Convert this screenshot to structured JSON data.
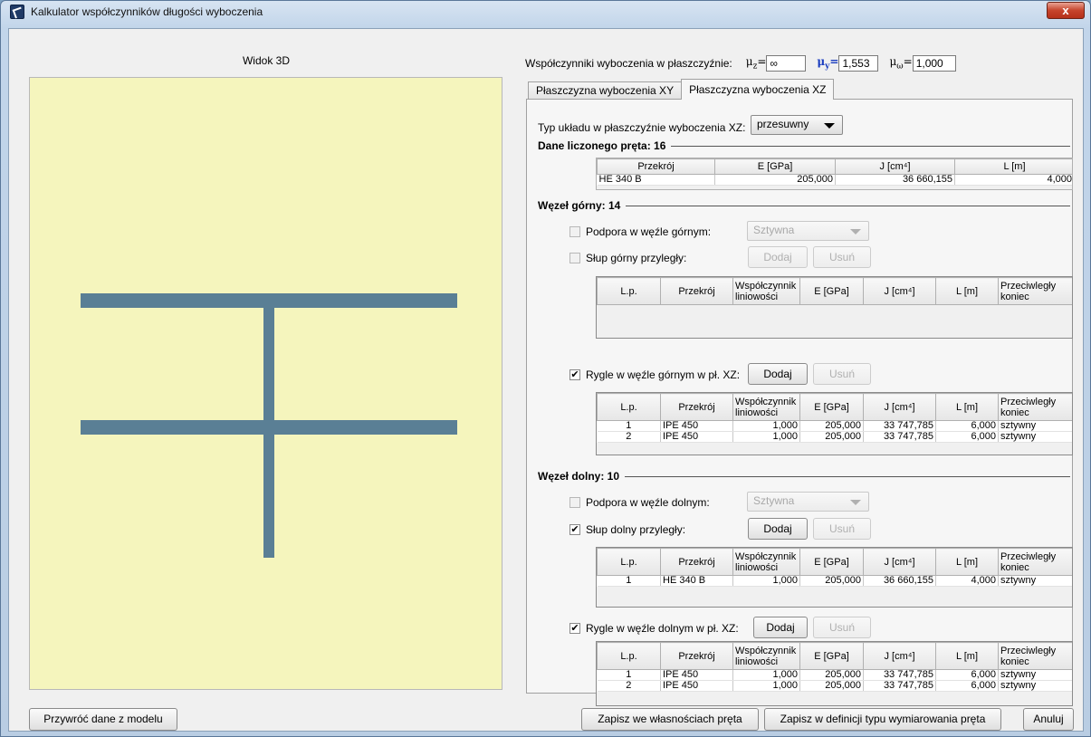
{
  "window": {
    "title": "Kalkulator współczynników długości wyboczenia",
    "close_label": "x"
  },
  "view3d": {
    "title": "Widok 3D",
    "background": "#f5f5bd",
    "member_color": "#5a7f95"
  },
  "coefficients": {
    "label": "Współczynniki wyboczenia w płaszczyźnie:",
    "mu_z": {
      "symbol": "μ",
      "sub": "z",
      "value": "∞"
    },
    "mu_y": {
      "symbol": "μ",
      "sub": "y",
      "value": "1,553"
    },
    "mu_w": {
      "symbol": "μ",
      "sub": "ω",
      "value": "1,000"
    }
  },
  "tabs": [
    {
      "label": "Płaszczyzna wyboczenia XY",
      "active": false
    },
    {
      "label": "Płaszczyzna wyboczenia XZ",
      "active": true
    }
  ],
  "system_type": {
    "label": "Typ układu w płaszczyźnie wyboczenia XZ:",
    "value": "przesuwny"
  },
  "member": {
    "title": "Dane liczonego pręta: 16",
    "headers": [
      "Przekrój",
      "E [GPa]",
      "J [cm⁴]",
      "L [m]"
    ],
    "row": [
      "HE 340 B",
      "205,000",
      "36 660,155",
      "4,000"
    ]
  },
  "grid_headers": [
    "L.p.",
    "Przekrój",
    "Współczynnik liniowości",
    "E [GPa]",
    "J [cm⁴]",
    "L [m]",
    "Przeciwległy koniec"
  ],
  "upper_node": {
    "title": "Węzeł górny: 14",
    "support": {
      "label": "Podpora w węźle górnym:",
      "checked": false,
      "combo": "Sztywna"
    },
    "column": {
      "label": "Słup górny przyległy:",
      "checked": false,
      "add": "Dodaj",
      "remove": "Usuń",
      "rows": []
    },
    "beams": {
      "label": "Rygle w węźle górnym w pł. XZ:",
      "checked": true,
      "add": "Dodaj",
      "remove": "Usuń",
      "rows": [
        [
          "1",
          "IPE 450",
          "1,000",
          "205,000",
          "33 747,785",
          "6,000",
          "sztywny"
        ],
        [
          "2",
          "IPE 450",
          "1,000",
          "205,000",
          "33 747,785",
          "6,000",
          "sztywny"
        ]
      ]
    }
  },
  "lower_node": {
    "title": "Węzeł dolny: 10",
    "support": {
      "label": "Podpora w węźle dolnym:",
      "checked": false,
      "combo": "Sztywna"
    },
    "column": {
      "label": "Słup dolny przyległy:",
      "checked": true,
      "add": "Dodaj",
      "remove": "Usuń",
      "rows": [
        [
          "1",
          "HE 340 B",
          "1,000",
          "205,000",
          "36 660,155",
          "4,000",
          "sztywny"
        ]
      ]
    },
    "beams": {
      "label": "Rygle w węźle dolnym w pł. XZ:",
      "checked": true,
      "add": "Dodaj",
      "remove": "Usuń",
      "rows": [
        [
          "1",
          "IPE 450",
          "1,000",
          "205,000",
          "33 747,785",
          "6,000",
          "sztywny"
        ],
        [
          "2",
          "IPE 450",
          "1,000",
          "205,000",
          "33 747,785",
          "6,000",
          "sztywny"
        ]
      ]
    }
  },
  "footer": {
    "restore": "Przywróć dane z modelu",
    "save_member": "Zapisz we własnościach pręta",
    "save_type": "Zapisz w definicji typu wymiarowania pręta",
    "cancel": "Anuluj"
  }
}
